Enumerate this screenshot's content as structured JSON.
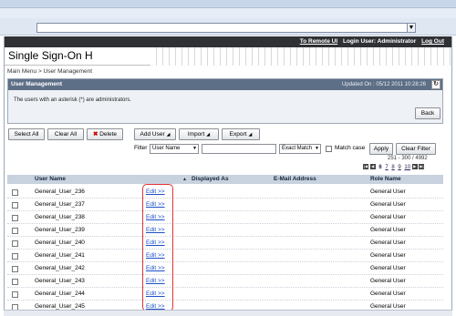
{
  "browser": {
    "address_value": "",
    "dropdown_icon": "triangle-down"
  },
  "topnav": {
    "remote_ui": "To Remote UI",
    "login_user": "Login User: Administrator",
    "logout": "Log Out"
  },
  "app": {
    "title": "Single Sign-On H"
  },
  "breadcrumb": "Main Menu > User Management",
  "panel": {
    "title": "User Management",
    "updated": "Updated On : 05/12 2011 10:28:26",
    "message": "The users with an asterisk (*) are administrators.",
    "back_label": "Back"
  },
  "toolbar": {
    "select_all": "Select All",
    "clear_all": "Clear All",
    "delete": "Delete",
    "add_user": "Add User",
    "import": "Import",
    "export": "Export"
  },
  "filter": {
    "label": "Filter",
    "field": "User Name",
    "value": "",
    "match": "Exact Match",
    "match_case": "Match case",
    "apply": "Apply",
    "clear": "Clear Filter"
  },
  "paging": {
    "range": "251 - 300 / 4992",
    "pages": [
      "6",
      "7",
      "8",
      "9",
      "10"
    ],
    "current": "6"
  },
  "table": {
    "headers": [
      "User Name",
      "Displayed As",
      "E-Mail Address",
      "Role Name"
    ],
    "edit_label": "Edit >>",
    "rows": [
      {
        "name": "General_User_236",
        "role": "General User"
      },
      {
        "name": "General_User_237",
        "role": "General User"
      },
      {
        "name": "General_User_238",
        "role": "General User"
      },
      {
        "name": "General_User_239",
        "role": "General User"
      },
      {
        "name": "General_User_240",
        "role": "General User"
      },
      {
        "name": "General_User_241",
        "role": "General User"
      },
      {
        "name": "General_User_242",
        "role": "General User"
      },
      {
        "name": "General_User_243",
        "role": "General User"
      },
      {
        "name": "General_User_244",
        "role": "General User"
      },
      {
        "name": "General_User_245",
        "role": "General User"
      }
    ]
  },
  "colors": {
    "header_dark": "#2f3135",
    "panel_head": "#5d6f86",
    "table_head": "#c8d2de",
    "link": "#1c4fc7",
    "highlight": "#e23333"
  }
}
